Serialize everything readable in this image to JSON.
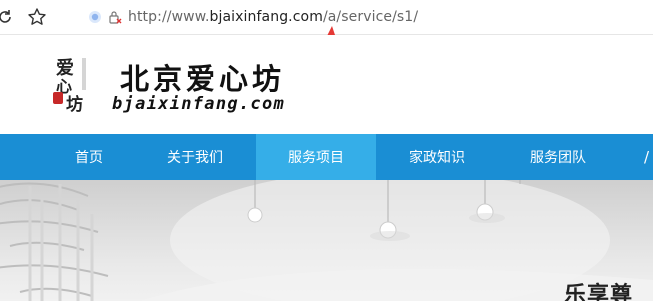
{
  "browser": {
    "url_prefix": "http://www.",
    "url_domain": "bjaixinfang.com",
    "url_path": "/a/service/s1/",
    "icons": [
      "refresh-icon",
      "star-icon",
      "shield-icon",
      "lock-warning-icon"
    ]
  },
  "site": {
    "brand_cn": "北京爱心坊",
    "brand_en": "bjaixinfang.com",
    "menu": [
      {
        "label": "首页"
      },
      {
        "label": "关于我们"
      },
      {
        "label": "服务项目"
      },
      {
        "label": "家政知识"
      },
      {
        "label": "服务团队"
      }
    ],
    "hero_text": "乐享尊"
  },
  "colors": {
    "menu_bg": "#1a8ed4",
    "menu_active": "#35aee8",
    "annotation_arrow": "#e53935"
  }
}
